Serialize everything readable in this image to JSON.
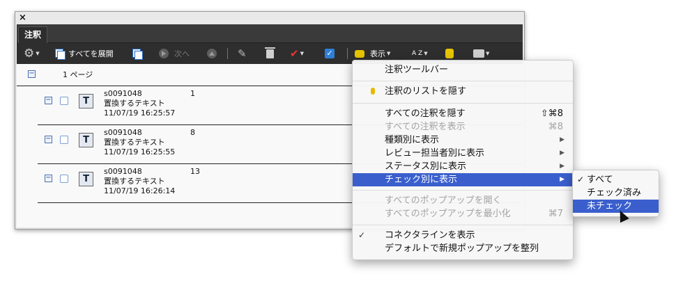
{
  "window": {
    "close_symbol": "×",
    "tab_label": "注釈"
  },
  "toolbar": {
    "options_icon": "gear-icon",
    "expand_all_label": "すべてを展開",
    "next_label": "次へ",
    "show_label": "表示",
    "sort_label": "A Z"
  },
  "list": {
    "page_label": "1 ページ",
    "rows": [
      {
        "author": "s0091048",
        "type": "置換するテキスト",
        "date": "11/07/19 16:25:57",
        "number": "1"
      },
      {
        "author": "s0091048",
        "type": "置換するテキスト",
        "date": "11/07/19 16:25:55",
        "number": "8"
      },
      {
        "author": "s0091048",
        "type": "置換するテキスト",
        "date": "11/07/19 16:26:14",
        "number": "13"
      }
    ]
  },
  "menu": {
    "comment_toolbar": "注釈ツールバー",
    "hide_list": "注釈のリストを隠す",
    "hide_all": "すべての注釈を隠す",
    "hide_all_shortcut": "⇧⌘8",
    "show_all": "すべての注釈を表示",
    "show_all_shortcut": "⌘8",
    "by_type": "種類別に表示",
    "by_reviewer": "レビュー担当者別に表示",
    "by_status": "ステータス別に表示",
    "by_checked": "チェック別に表示",
    "open_popups": "すべてのポップアップを開く",
    "minimize_popups": "すべてのポップアップを最小化",
    "minimize_shortcut": "⌘7",
    "connector_lines": "コネクタラインを表示",
    "align_popups": "デフォルトで新規ポップアップを整列",
    "check_mark": "✓",
    "arrow": "▶"
  },
  "submenu": {
    "all": "すべて",
    "checked": "チェック済み",
    "unchecked": "未チェック"
  },
  "colors": {
    "highlight": "#3a5fcd",
    "panel": "#2e2e2e"
  }
}
